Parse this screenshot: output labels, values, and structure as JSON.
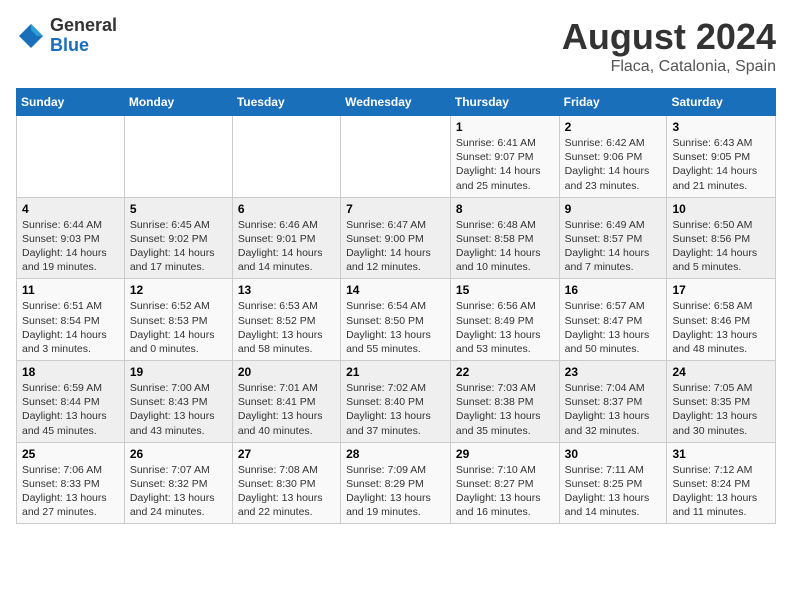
{
  "header": {
    "logo_general": "General",
    "logo_blue": "Blue",
    "month_title": "August 2024",
    "location": "Flaca, Catalonia, Spain"
  },
  "weekdays": [
    "Sunday",
    "Monday",
    "Tuesday",
    "Wednesday",
    "Thursday",
    "Friday",
    "Saturday"
  ],
  "weeks": [
    [
      {
        "day": "",
        "info": ""
      },
      {
        "day": "",
        "info": ""
      },
      {
        "day": "",
        "info": ""
      },
      {
        "day": "",
        "info": ""
      },
      {
        "day": "1",
        "info": "Sunrise: 6:41 AM\nSunset: 9:07 PM\nDaylight: 14 hours\nand 25 minutes."
      },
      {
        "day": "2",
        "info": "Sunrise: 6:42 AM\nSunset: 9:06 PM\nDaylight: 14 hours\nand 23 minutes."
      },
      {
        "day": "3",
        "info": "Sunrise: 6:43 AM\nSunset: 9:05 PM\nDaylight: 14 hours\nand 21 minutes."
      }
    ],
    [
      {
        "day": "4",
        "info": "Sunrise: 6:44 AM\nSunset: 9:03 PM\nDaylight: 14 hours\nand 19 minutes."
      },
      {
        "day": "5",
        "info": "Sunrise: 6:45 AM\nSunset: 9:02 PM\nDaylight: 14 hours\nand 17 minutes."
      },
      {
        "day": "6",
        "info": "Sunrise: 6:46 AM\nSunset: 9:01 PM\nDaylight: 14 hours\nand 14 minutes."
      },
      {
        "day": "7",
        "info": "Sunrise: 6:47 AM\nSunset: 9:00 PM\nDaylight: 14 hours\nand 12 minutes."
      },
      {
        "day": "8",
        "info": "Sunrise: 6:48 AM\nSunset: 8:58 PM\nDaylight: 14 hours\nand 10 minutes."
      },
      {
        "day": "9",
        "info": "Sunrise: 6:49 AM\nSunset: 8:57 PM\nDaylight: 14 hours\nand 7 minutes."
      },
      {
        "day": "10",
        "info": "Sunrise: 6:50 AM\nSunset: 8:56 PM\nDaylight: 14 hours\nand 5 minutes."
      }
    ],
    [
      {
        "day": "11",
        "info": "Sunrise: 6:51 AM\nSunset: 8:54 PM\nDaylight: 14 hours\nand 3 minutes."
      },
      {
        "day": "12",
        "info": "Sunrise: 6:52 AM\nSunset: 8:53 PM\nDaylight: 14 hours\nand 0 minutes."
      },
      {
        "day": "13",
        "info": "Sunrise: 6:53 AM\nSunset: 8:52 PM\nDaylight: 13 hours\nand 58 minutes."
      },
      {
        "day": "14",
        "info": "Sunrise: 6:54 AM\nSunset: 8:50 PM\nDaylight: 13 hours\nand 55 minutes."
      },
      {
        "day": "15",
        "info": "Sunrise: 6:56 AM\nSunset: 8:49 PM\nDaylight: 13 hours\nand 53 minutes."
      },
      {
        "day": "16",
        "info": "Sunrise: 6:57 AM\nSunset: 8:47 PM\nDaylight: 13 hours\nand 50 minutes."
      },
      {
        "day": "17",
        "info": "Sunrise: 6:58 AM\nSunset: 8:46 PM\nDaylight: 13 hours\nand 48 minutes."
      }
    ],
    [
      {
        "day": "18",
        "info": "Sunrise: 6:59 AM\nSunset: 8:44 PM\nDaylight: 13 hours\nand 45 minutes."
      },
      {
        "day": "19",
        "info": "Sunrise: 7:00 AM\nSunset: 8:43 PM\nDaylight: 13 hours\nand 43 minutes."
      },
      {
        "day": "20",
        "info": "Sunrise: 7:01 AM\nSunset: 8:41 PM\nDaylight: 13 hours\nand 40 minutes."
      },
      {
        "day": "21",
        "info": "Sunrise: 7:02 AM\nSunset: 8:40 PM\nDaylight: 13 hours\nand 37 minutes."
      },
      {
        "day": "22",
        "info": "Sunrise: 7:03 AM\nSunset: 8:38 PM\nDaylight: 13 hours\nand 35 minutes."
      },
      {
        "day": "23",
        "info": "Sunrise: 7:04 AM\nSunset: 8:37 PM\nDaylight: 13 hours\nand 32 minutes."
      },
      {
        "day": "24",
        "info": "Sunrise: 7:05 AM\nSunset: 8:35 PM\nDaylight: 13 hours\nand 30 minutes."
      }
    ],
    [
      {
        "day": "25",
        "info": "Sunrise: 7:06 AM\nSunset: 8:33 PM\nDaylight: 13 hours\nand 27 minutes."
      },
      {
        "day": "26",
        "info": "Sunrise: 7:07 AM\nSunset: 8:32 PM\nDaylight: 13 hours\nand 24 minutes."
      },
      {
        "day": "27",
        "info": "Sunrise: 7:08 AM\nSunset: 8:30 PM\nDaylight: 13 hours\nand 22 minutes."
      },
      {
        "day": "28",
        "info": "Sunrise: 7:09 AM\nSunset: 8:29 PM\nDaylight: 13 hours\nand 19 minutes."
      },
      {
        "day": "29",
        "info": "Sunrise: 7:10 AM\nSunset: 8:27 PM\nDaylight: 13 hours\nand 16 minutes."
      },
      {
        "day": "30",
        "info": "Sunrise: 7:11 AM\nSunset: 8:25 PM\nDaylight: 13 hours\nand 14 minutes."
      },
      {
        "day": "31",
        "info": "Sunrise: 7:12 AM\nSunset: 8:24 PM\nDaylight: 13 hours\nand 11 minutes."
      }
    ]
  ]
}
